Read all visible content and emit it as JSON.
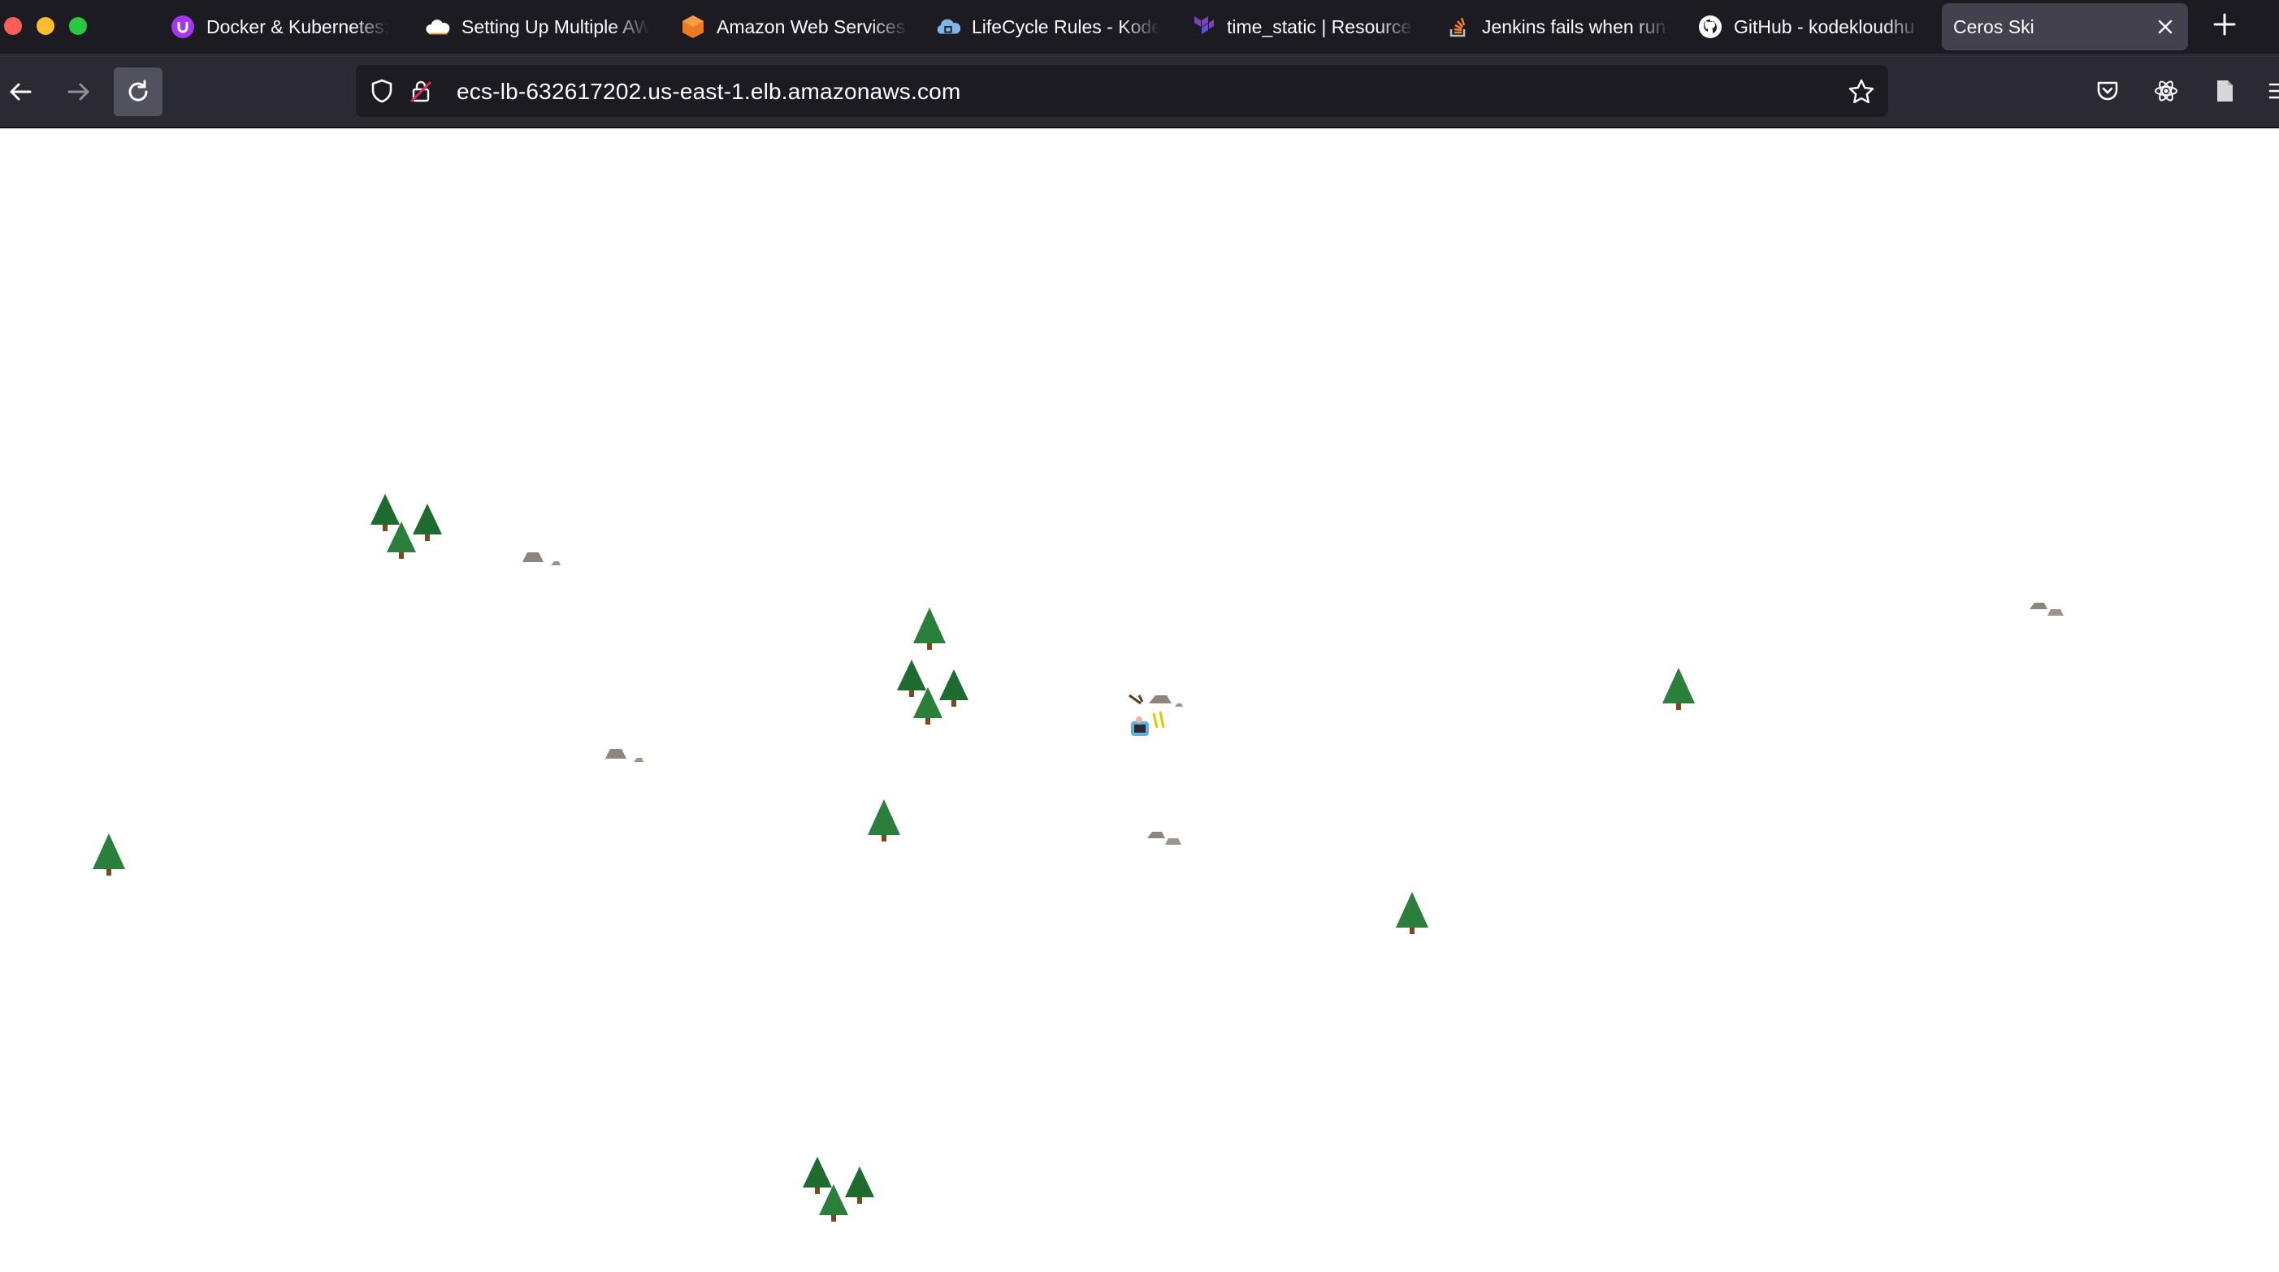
{
  "browser": {
    "tabs": [
      {
        "title": "Docker & Kubernetes:",
        "icon": "udemy-icon"
      },
      {
        "title": "Setting Up Multiple AW",
        "icon": "cloud-icon"
      },
      {
        "title": "Amazon Web Services",
        "icon": "aws-hexagon-icon"
      },
      {
        "title": "LifeCycle Rules - Kode",
        "icon": "kodekloud-icon"
      },
      {
        "title": "time_static | Resource",
        "icon": "terraform-icon"
      },
      {
        "title": "Jenkins fails when run",
        "icon": "stackoverflow-icon"
      },
      {
        "title": "GitHub - kodekloudhu",
        "icon": "github-icon"
      },
      {
        "title": "Ceros Ski",
        "icon": "none",
        "active": true
      }
    ],
    "address": "ecs-lb-632617202.us-east-1.elb.amazonaws.com"
  },
  "colors": {
    "tabbar_bg": "#1c1b22",
    "toolbar_bg": "#2b2a33",
    "active_tab_bg": "#42414d",
    "tree_green": "#1d6b2f",
    "trunk_brown": "#7a4a1e",
    "rock_gray": "#8c8580"
  },
  "game": {
    "title": "Ceros Ski",
    "objects": [
      {
        "type": "tree-cluster"
      },
      {
        "type": "rock"
      },
      {
        "type": "tree"
      },
      {
        "type": "tree"
      },
      {
        "type": "rock"
      },
      {
        "type": "tree-cluster"
      },
      {
        "type": "skier"
      },
      {
        "type": "rock"
      },
      {
        "type": "tree"
      },
      {
        "type": "rock"
      },
      {
        "type": "tree"
      },
      {
        "type": "tree"
      },
      {
        "type": "tree"
      },
      {
        "type": "tree-cluster"
      }
    ]
  }
}
